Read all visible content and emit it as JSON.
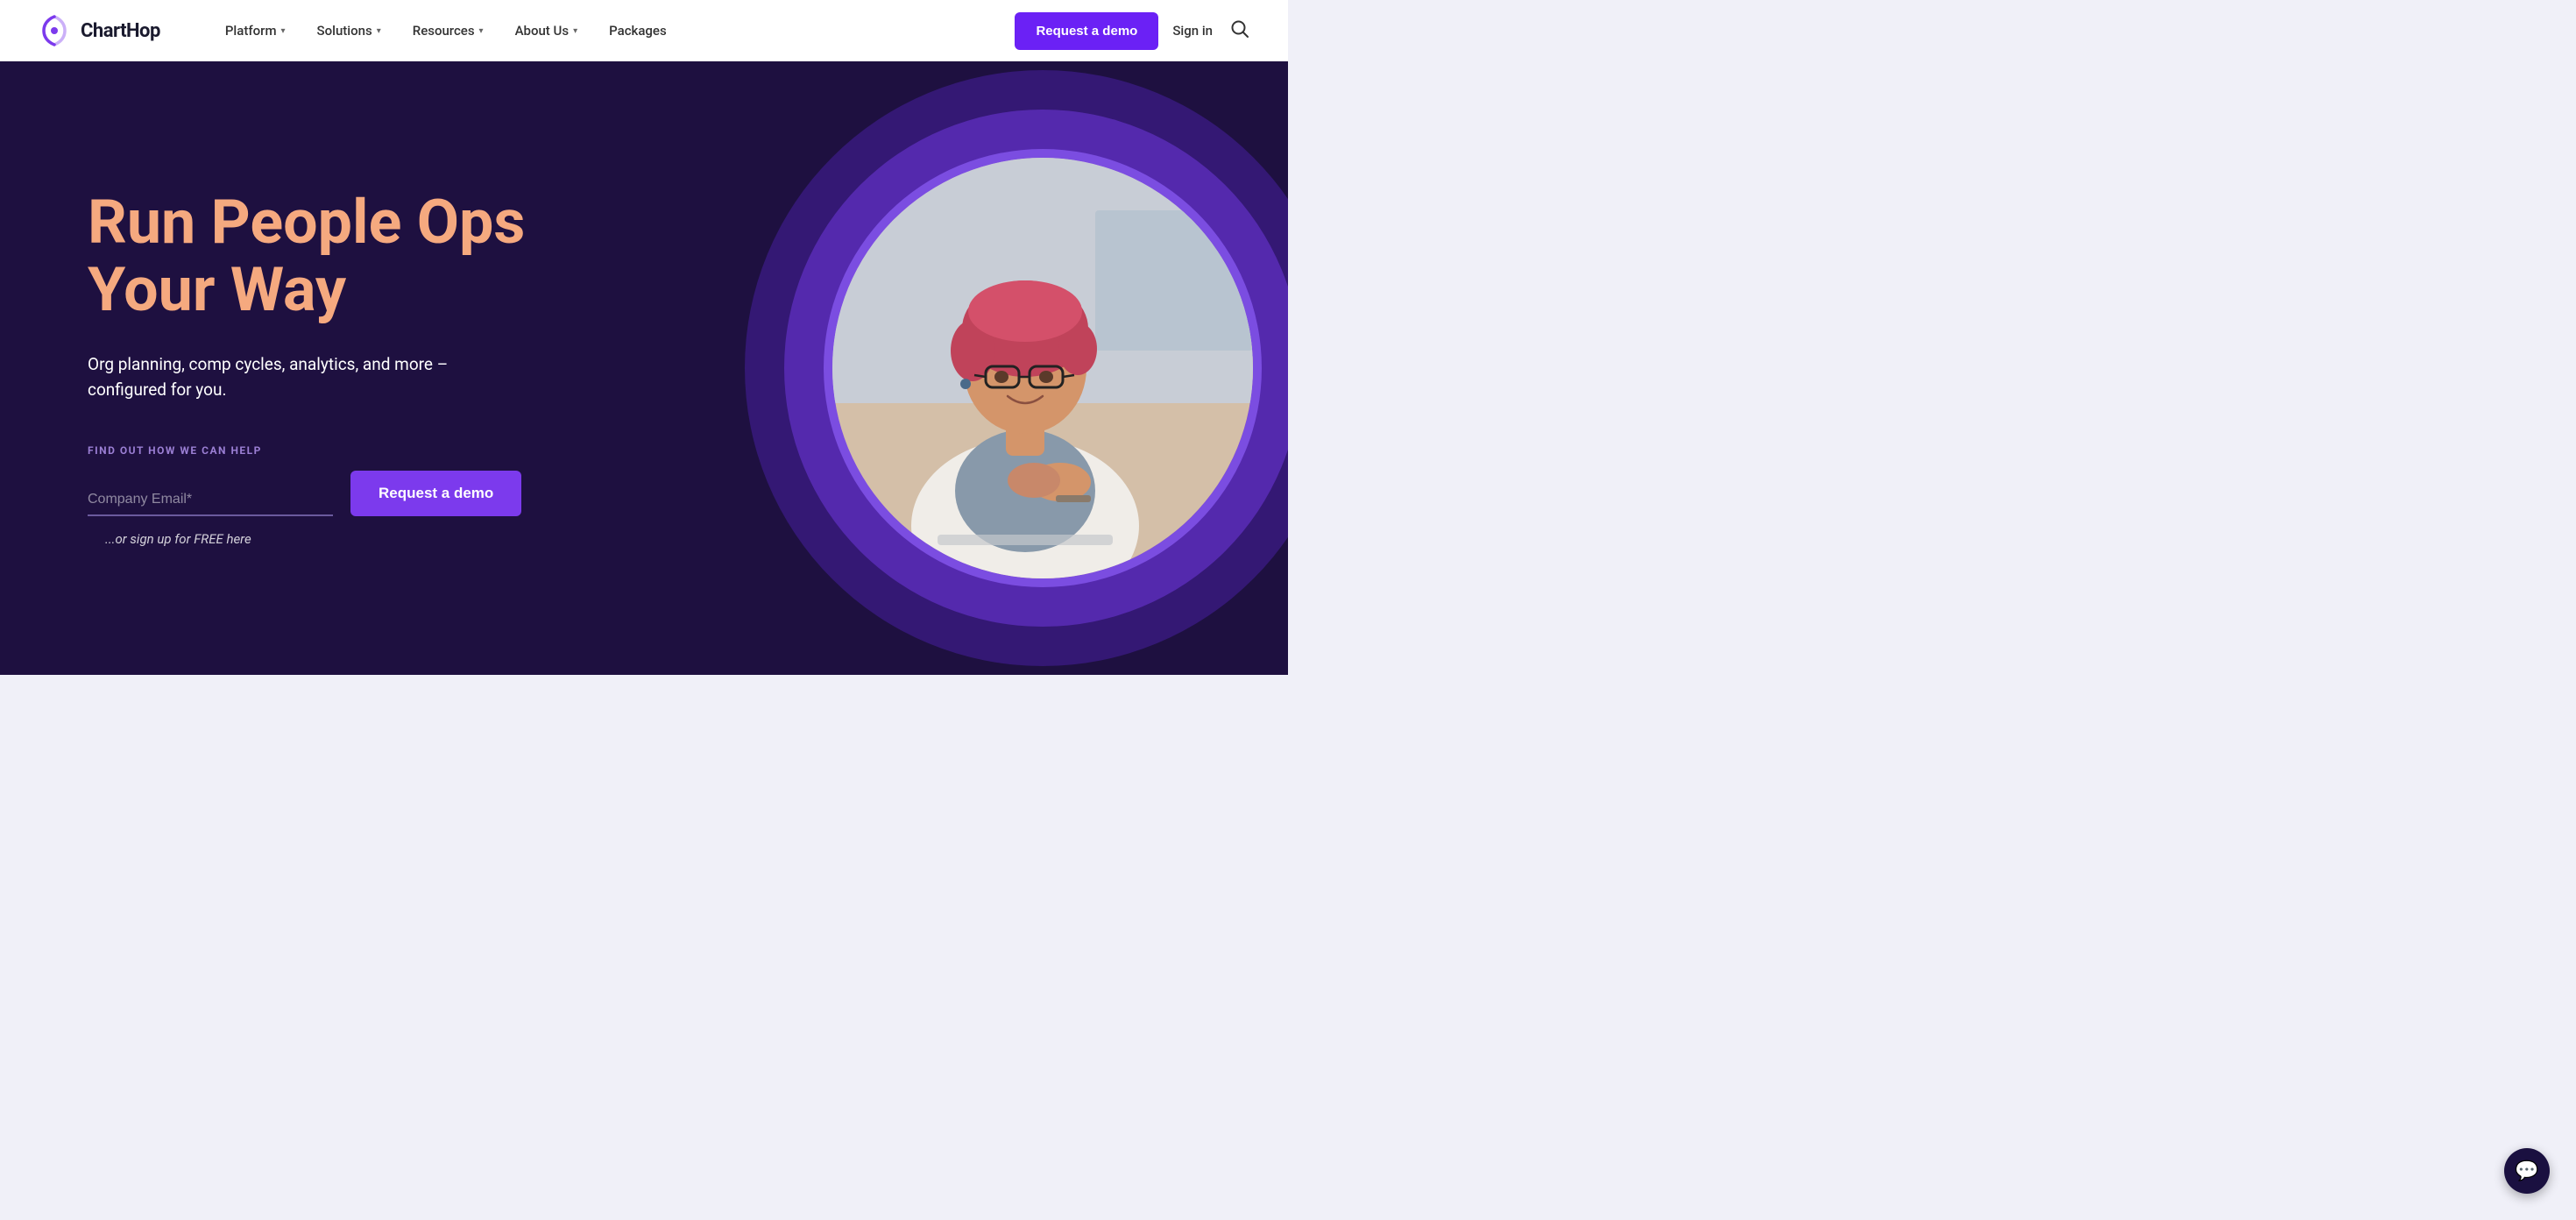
{
  "logo": {
    "text": "ChartHop",
    "alt": "ChartHop logo"
  },
  "nav": {
    "items": [
      {
        "label": "Platform",
        "hasDropdown": true
      },
      {
        "label": "Solutions",
        "hasDropdown": true
      },
      {
        "label": "Resources",
        "hasDropdown": true
      },
      {
        "label": "About Us",
        "hasDropdown": true
      },
      {
        "label": "Packages",
        "hasDropdown": false
      }
    ],
    "cta": "Request a demo",
    "signIn": "Sign in"
  },
  "hero": {
    "title": "Run People Ops Your Way",
    "subtitle": "Org planning, comp cycles, analytics, and more – configured for you.",
    "formLabel": "FIND OUT HOW WE CAN HELP",
    "emailPlaceholder": "Company Email*",
    "ctaButton": "Request a demo",
    "signupLink": "...or sign up for FREE here"
  },
  "chat": {
    "ariaLabel": "Open chat"
  },
  "colors": {
    "navBg": "#ffffff",
    "heroBg": "#1e1040",
    "heroTitle": "#f5a97f",
    "heroPurple": "#7c3aed",
    "accentPurple": "#6b21f5"
  }
}
